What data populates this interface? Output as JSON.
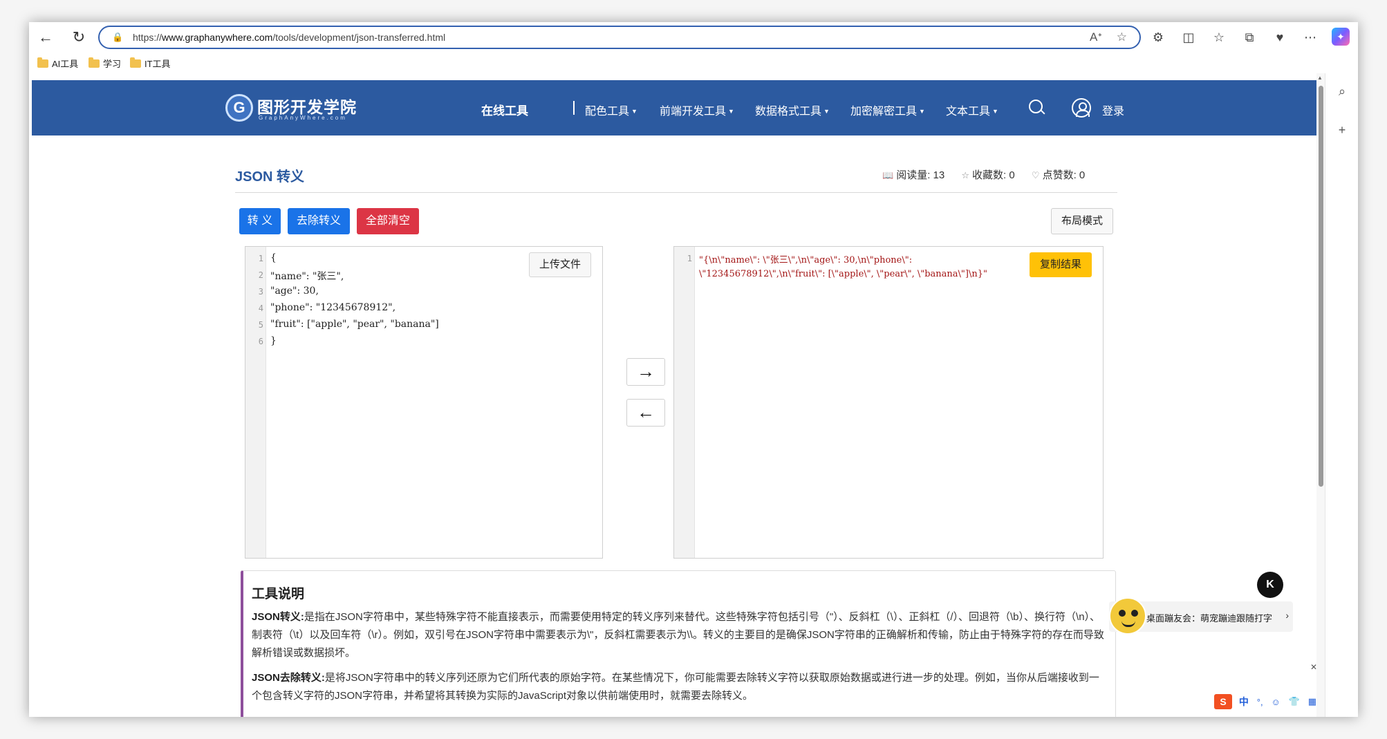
{
  "browser": {
    "url_prefix": "https://",
    "url_domain": "www.graphanywhere.com",
    "url_path": "/tools/development/json-transferred.html",
    "bookmarks": [
      "AI工具",
      "学习",
      "IT工具"
    ]
  },
  "site": {
    "logo_title": "图形开发学院",
    "logo_sub": "GraphAnyWhere.com",
    "nav_main": "在线工具",
    "nav_items": [
      "配色工具",
      "前端开发工具",
      "数据格式工具",
      "加密解密工具",
      "文本工具"
    ],
    "login": "登录"
  },
  "page": {
    "title": "JSON 转义",
    "stats": {
      "views_label": "阅读量:",
      "views": "13",
      "favs_label": "收藏数:",
      "favs": "0",
      "likes_label": "点赞数:",
      "likes": "0"
    },
    "buttons": {
      "escape": "转 义",
      "unescape": "去除转义",
      "clear": "全部清空",
      "layout": "布局模式",
      "upload": "上传文件",
      "copy": "复制结果",
      "to_right": "→",
      "to_left": "←"
    }
  },
  "input_editor": {
    "line_numbers": [
      "1",
      "2",
      "3",
      "4",
      "5",
      "6"
    ],
    "lines": [
      "{",
      "\"name\": \"张三\",",
      "\"age\": 30,",
      "\"phone\": \"12345678912\",",
      "\"fruit\": [\"apple\", \"pear\", \"banana\"]",
      "}"
    ]
  },
  "output_editor": {
    "line_numbers": [
      "1"
    ],
    "lines": [
      "\"{\\n\\\"name\\\": \\\"张三\\\",\\n\\\"age\\\": 30,\\n\\\"phone\\\":",
      "\\\"12345678912\\\",\\n\\\"fruit\\\": [\\\"apple\\\", \\\"pear\\\", \\\"banana\\\"]\\n}\""
    ]
  },
  "description": {
    "heading": "工具说明",
    "p1_label": "JSON转义:",
    "p1_text": "是指在JSON字符串中，某些特殊字符不能直接表示，而需要使用特定的转义序列来替代。这些特殊字符包括引号（\"）、反斜杠（\\）、正斜杠（/）、回退符（\\b）、换行符（\\n）、制表符（\\t）以及回车符（\\r）。例如，双引号在JSON字符串中需要表示为\\\"，反斜杠需要表示为\\\\。转义的主要目的是确保JSON字符串的正确解析和传输，防止由于特殊字符的存在而导致解析错误或数据损坏。",
    "p2_label": "JSON去除转义:",
    "p2_text": "是将JSON字符串中的转义序列还原为它们所代表的原始字符。在某些情况下，你可能需要去除转义字符以获取原始数据或进行进一步的处理。例如，当你从后端接收到一个包含转义字符的JSON字符串，并希望将其转换为实际的JavaScript对象以供前端使用时，就需要去除转义。"
  },
  "floating": {
    "help_badge": "K",
    "ad_text": "桌面蹦友会：萌宠蹦迪跟随打字",
    "ime_lang": "中"
  },
  "colors": {
    "header_blue": "#2c5aa0",
    "button_blue": "#1a73e8",
    "button_red": "#dc3545",
    "copy_yellow": "#ffc107",
    "desc_accent": "#8e4f9c"
  }
}
